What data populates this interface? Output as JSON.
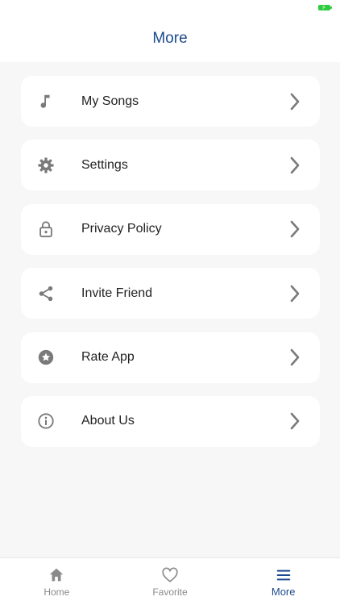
{
  "header": {
    "title": "More"
  },
  "menu": {
    "items": [
      {
        "label": "My Songs",
        "icon": "music-note-icon"
      },
      {
        "label": "Settings",
        "icon": "gear-icon"
      },
      {
        "label": "Privacy Policy",
        "icon": "lock-icon"
      },
      {
        "label": "Invite Friend",
        "icon": "share-icon"
      },
      {
        "label": "Rate App",
        "icon": "star-circle-icon"
      },
      {
        "label": "About Us",
        "icon": "info-icon"
      }
    ]
  },
  "tabbar": {
    "tabs": [
      {
        "label": "Home",
        "icon": "home-icon",
        "active": false
      },
      {
        "label": "Favorite",
        "icon": "heart-icon",
        "active": false
      },
      {
        "label": "More",
        "icon": "menu-icon",
        "active": true
      }
    ]
  },
  "colors": {
    "accent": "#1c4a8e",
    "icon": "#8a8a8a",
    "battery": "#2ecc40"
  }
}
